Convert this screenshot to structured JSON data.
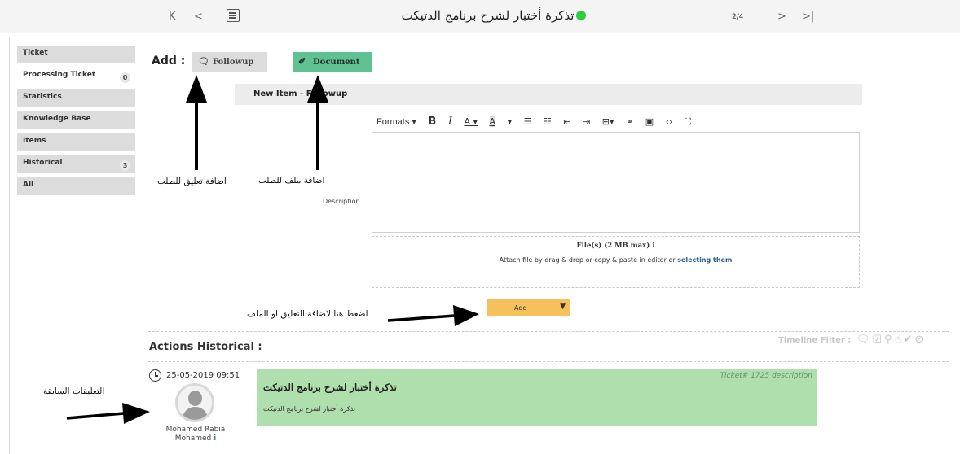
{
  "topbar": {
    "first_label": "K",
    "prev_label": "<",
    "ticket_title": "تذكرة أختبار لشرح برنامج الدتيكت",
    "status_color": "#2ecc40",
    "counter": "2/4",
    "next_label": ">",
    "last_label": ">|"
  },
  "sidebar": {
    "items": [
      {
        "label": "Ticket",
        "badge": ""
      },
      {
        "label": "Processing Ticket",
        "badge": "0"
      },
      {
        "label": "Statistics",
        "badge": ""
      },
      {
        "label": "Knowledge Base",
        "badge": ""
      },
      {
        "label": "Items",
        "badge": ""
      },
      {
        "label": "Historical",
        "badge": "3"
      },
      {
        "label": "All",
        "badge": ""
      }
    ]
  },
  "add": {
    "label": "Add :",
    "followup": "Followup",
    "document": "Document",
    "followup_icon": "comment-icon",
    "document_icon": "paperclip-icon",
    "document_color": "#5fc293"
  },
  "form": {
    "new_item": "New Item - Followup",
    "formats": "Formats ▾",
    "description_label": "Description",
    "files_title": "File(s) (2 MB max)",
    "files_info": "i",
    "files_hint": "Attach file by drag & drop or copy & paste in editor or",
    "files_link": "selecting them",
    "add_button": "Add",
    "add_button_color": "#f6c15b"
  },
  "history": {
    "title": "Actions Historical :",
    "timeline_filter": "Timeline Filter :",
    "entries": [
      {
        "date": "25-05-2019 09:51",
        "author_line1": "Mohamed Rabia",
        "author_line2": "Mohamed",
        "author_info": "i",
        "ticket_ref": "Ticket# 1725 description",
        "title": "تذكرة أختبار لشرح برنامج الدتيكت",
        "body": "تذكرة أختبار لشرح برنامج الدتيكت",
        "color": "#aedfac"
      }
    ]
  },
  "annotations": {
    "add_comment": "اضافة تعليق للطلب",
    "add_file": "اضافة ملف للطلب",
    "press_add": "اضغط هنا لاضافة التعليق او الملف",
    "previous_comments": "التعليقات السابقة"
  }
}
